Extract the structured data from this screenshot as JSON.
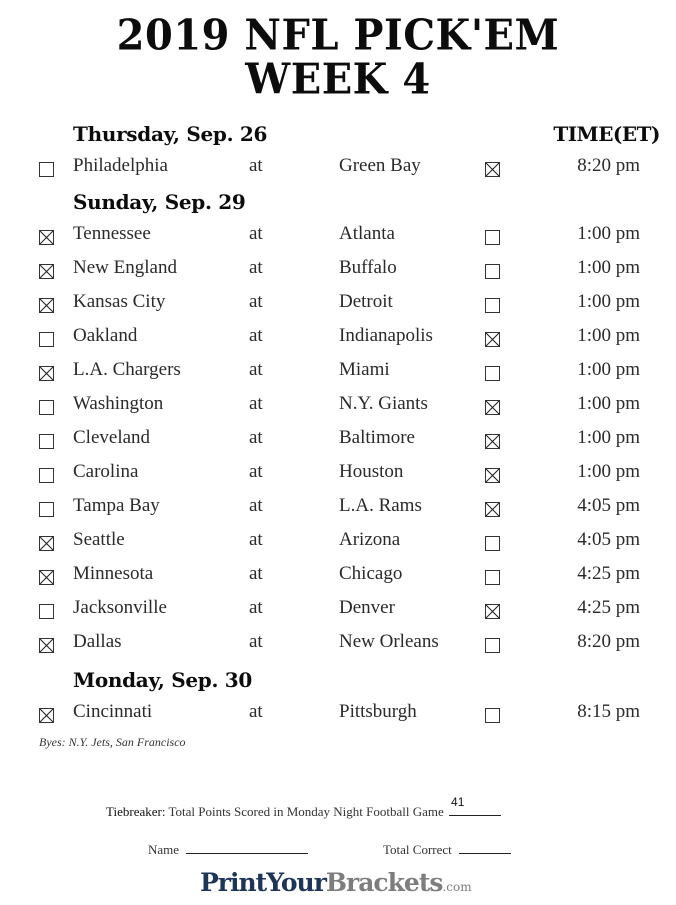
{
  "header": {
    "title_line1": "2019 NFL PICK'EM",
    "title_line2": "WEEK 4",
    "time_header": "TIME(ET)"
  },
  "days": [
    {
      "label": "Thursday, Sep. 26",
      "games": [
        {
          "away": "Philadelphia",
          "at": "at",
          "home": "Green Bay",
          "time": "8:20 pm",
          "away_checked": false,
          "home_checked": true
        }
      ]
    },
    {
      "label": "Sunday, Sep. 29",
      "games": [
        {
          "away": "Tennessee",
          "at": "at",
          "home": "Atlanta",
          "time": "1:00 pm",
          "away_checked": true,
          "home_checked": false
        },
        {
          "away": "New England",
          "at": "at",
          "home": "Buffalo",
          "time": "1:00 pm",
          "away_checked": true,
          "home_checked": false
        },
        {
          "away": "Kansas City",
          "at": "at",
          "home": "Detroit",
          "time": "1:00 pm",
          "away_checked": true,
          "home_checked": false
        },
        {
          "away": "Oakland",
          "at": "at",
          "home": "Indianapolis",
          "time": "1:00 pm",
          "away_checked": false,
          "home_checked": true
        },
        {
          "away": "L.A. Chargers",
          "at": "at",
          "home": "Miami",
          "time": "1:00 pm",
          "away_checked": true,
          "home_checked": false
        },
        {
          "away": "Washington",
          "at": "at",
          "home": "N.Y. Giants",
          "time": "1:00 pm",
          "away_checked": false,
          "home_checked": true
        },
        {
          "away": "Cleveland",
          "at": "at",
          "home": "Baltimore",
          "time": "1:00 pm",
          "away_checked": false,
          "home_checked": true
        },
        {
          "away": "Carolina",
          "at": "at",
          "home": "Houston",
          "time": "1:00 pm",
          "away_checked": false,
          "home_checked": true
        },
        {
          "away": "Tampa Bay",
          "at": "at",
          "home": "L.A. Rams",
          "time": "4:05 pm",
          "away_checked": false,
          "home_checked": true
        },
        {
          "away": "Seattle",
          "at": "at",
          "home": "Arizona",
          "time": "4:05 pm",
          "away_checked": true,
          "home_checked": false
        },
        {
          "away": "Minnesota",
          "at": "at",
          "home": "Chicago",
          "time": "4:25 pm",
          "away_checked": true,
          "home_checked": false
        },
        {
          "away": "Jacksonville",
          "at": "at",
          "home": "Denver",
          "time": "4:25 pm",
          "away_checked": false,
          "home_checked": true
        },
        {
          "away": "Dallas",
          "at": "at",
          "home": "New Orleans",
          "time": "8:20 pm",
          "away_checked": true,
          "home_checked": false
        }
      ]
    },
    {
      "label": "Monday, Sep. 30",
      "games": [
        {
          "away": "Cincinnati",
          "at": "at",
          "home": "Pittsburgh",
          "time": "8:15 pm",
          "away_checked": true,
          "home_checked": false
        }
      ]
    }
  ],
  "byes": "Byes: N.Y. Jets, San Francisco",
  "footer": {
    "tiebreaker_label": "Tiebreaker:",
    "tiebreaker_text": "Total Points Scored in Monday Night Football Game",
    "tiebreaker_value": "41",
    "name_label": "Name",
    "name_value": "",
    "total_correct_label": "Total Correct",
    "total_correct_value": ""
  },
  "logo": {
    "part1": "PrintYour",
    "part2": "Brackets",
    "part3": ".com",
    "color_primary": "#1d3557",
    "color_secondary": "#7d7d7d"
  }
}
